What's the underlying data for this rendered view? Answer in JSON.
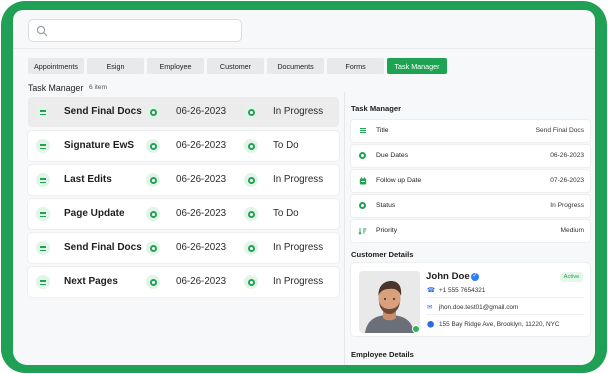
{
  "search": {
    "placeholder": ""
  },
  "tabs": [
    {
      "label": "Appointments",
      "active": false
    },
    {
      "label": "Esign",
      "active": false
    },
    {
      "label": "Employee",
      "active": false
    },
    {
      "label": "Customer",
      "active": false
    },
    {
      "label": "Documents",
      "active": false
    },
    {
      "label": "Forms",
      "active": false
    },
    {
      "label": "Task Manager",
      "active": true
    }
  ],
  "task_manager": {
    "title": "Task Manager",
    "count": "6 item",
    "tasks": [
      {
        "name": "Send Final Docs",
        "date": "06-26-2023",
        "status": "In Progress",
        "selected": true
      },
      {
        "name": "Signature EwS",
        "date": "06-26-2023",
        "status": "To Do"
      },
      {
        "name": "Last Edits",
        "date": "06-26-2023",
        "status": "In Progress"
      },
      {
        "name": "Page Update",
        "date": "06-26-2023",
        "status": "To Do"
      },
      {
        "name": "Send Final Docs",
        "date": "06-26-2023",
        "status": "In Progress"
      },
      {
        "name": "Next Pages",
        "date": "06-26-2023",
        "status": "In Progress"
      }
    ]
  },
  "detail_panel": {
    "title": "Task Manager",
    "rows": [
      {
        "label": "Title",
        "value": "Send Final Docs",
        "icon": "list-icon"
      },
      {
        "label": "Due Dates",
        "value": "06-26-2023",
        "icon": "clock-icon"
      },
      {
        "label": "Follow up Date",
        "value": "07-26-2023",
        "icon": "calendar-icon"
      },
      {
        "label": "Status",
        "value": "In Progress",
        "icon": "status-icon"
      },
      {
        "label": "Priority",
        "value": "Medium",
        "icon": "sort-icon"
      }
    ]
  },
  "customer": {
    "section_title": "Customer Details",
    "name": "John Doe",
    "badge": "Active",
    "phone": "+1 555 7654321",
    "email": "jhon.doe.test01@gmail.com",
    "address": "155 Bay Ridge Ave, Brooklyn, 11220, NYC"
  },
  "employee": {
    "section_title": "Employee Details"
  },
  "colors": {
    "accent": "#1ea352",
    "frame": "#1fa055",
    "link": "#2d6cdf"
  }
}
